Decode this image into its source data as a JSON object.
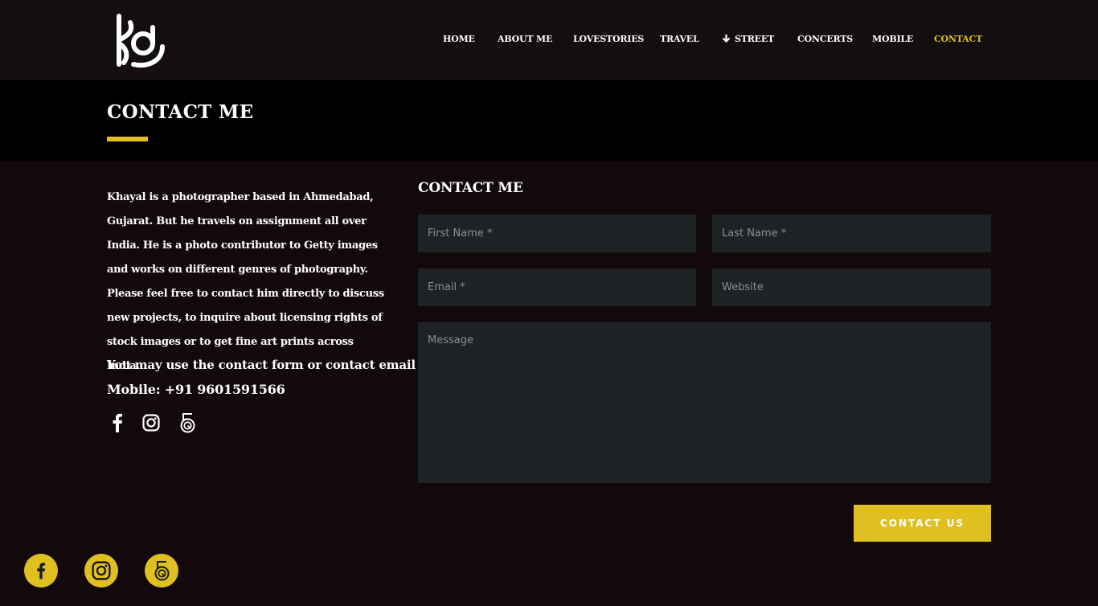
{
  "nav": {
    "items": [
      {
        "label": "HOME"
      },
      {
        "label": "ABOUT ME"
      },
      {
        "label": "LOVESTORIES"
      },
      {
        "label": "TRAVEL"
      },
      {
        "label": "STREET"
      },
      {
        "label": "CONCERTS"
      },
      {
        "label": "MOBILE"
      },
      {
        "label": "CONTACT"
      }
    ],
    "active": "CONTACT"
  },
  "page": {
    "title": "CONTACT ME"
  },
  "about": {
    "intro": "Khayal is a photographer based in Ahmedabad, Gujarat. But he travels on assignment all over India. He is a photo contributor to Getty images and works on different genres of photography. Please feel free to contact him directly to discuss new projects, to inquire about licensing rights of stock images or to get fine art prints across India.",
    "contact_line": "You may use the contact form or contact email :",
    "mobile_line": "Mobile: +91 9601591566"
  },
  "form": {
    "heading": "CONTACT ME",
    "first_name_placeholder": "First Name *",
    "last_name_placeholder": "Last Name *",
    "email_placeholder": "Email *",
    "website_placeholder": "Website",
    "message_placeholder": "Message",
    "submit_label": "CONTACT US"
  },
  "social": {
    "icons": [
      "facebook-icon",
      "instagram-icon",
      "500px-icon"
    ]
  },
  "colors": {
    "accent": "#e0c020",
    "background": "#13090c",
    "header_bg": "#130e10",
    "title_band_bg": "#000000",
    "field_bg": "#1d2225"
  }
}
